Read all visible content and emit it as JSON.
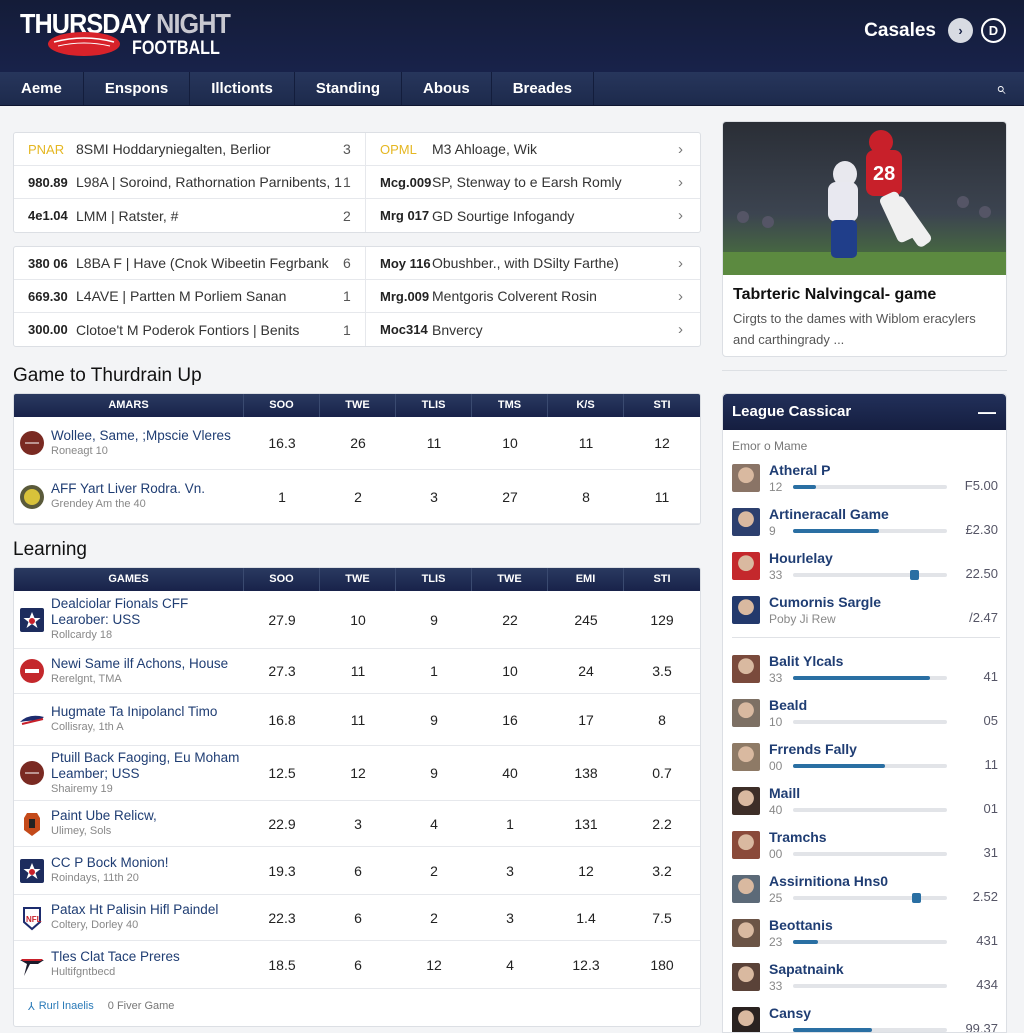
{
  "header": {
    "logo_text_1": "THURSDAY",
    "logo_text_2": "NIGHT",
    "logo_text_3": "FOOTBALL",
    "user_name": "Casales",
    "user_icon_1": "chevron-right-icon",
    "user_icon_2": "d-circle-icon"
  },
  "nav": {
    "items": [
      "Aeme",
      "Enspons",
      "Illctionts",
      "Standing",
      "Abous",
      "Breades"
    ],
    "search_icon": "search-icon"
  },
  "schedule_boxes": [
    [
      {
        "left": {
          "code": "PNAR",
          "text": "8SMI Hoddaryniegalten, Berlior",
          "num": "3"
        },
        "right": {
          "code": "OPML",
          "text": "M3 Ahloage, Wik"
        }
      },
      {
        "left": {
          "code": "980.89",
          "text": "L98A | Soroind, Rathornation Parnibents, 1",
          "num": "1"
        },
        "right": {
          "code": "Mcg.009",
          "text": "SP, Stenway to e Earsh Romly"
        }
      },
      {
        "left": {
          "code": "4e1.04",
          "text": "LMM | Ratster, #",
          "num": "2"
        },
        "right": {
          "code": "Mrg 017",
          "text": "GD Sourtige Infogandy"
        }
      }
    ],
    [
      {
        "left": {
          "code": "380 06",
          "text": "L8BA F | Have (Cnok Wibeetin Fegrbank",
          "num": "6"
        },
        "right": {
          "code": "Moy 116",
          "text": "Obushber., with DSilty Farthe)"
        }
      },
      {
        "left": {
          "code": "669.30",
          "text": "L4AVE | Partten M Porliem Sanan",
          "num": "1"
        },
        "right": {
          "code": "Mrg.009",
          "text": "Mentgoris Colverent Rosin"
        }
      },
      {
        "left": {
          "code": "300.00",
          "text": "Clotoe't M Poderok Fontiors | Benits",
          "num": "1"
        },
        "right": {
          "code": "Moc314",
          "text": "Bnvercy"
        }
      }
    ]
  ],
  "section1": {
    "title": "Game to Thurdrain Up",
    "columns": [
      "AMARS",
      "SOO",
      "TWE",
      "TLIS",
      "TMS",
      "K/S",
      "STI"
    ],
    "rows": [
      {
        "icon": "football-icon",
        "name": "Wollee, Same, ;Mpscie Vleres",
        "sub": "Roneagt 10",
        "values": [
          "16.3",
          "26",
          "11",
          "10",
          "11",
          "12"
        ]
      },
      {
        "icon": "team-badge-icon",
        "name": "AFF Yart Liver Rodra. Vn.",
        "sub": "Grendey Am the 40",
        "values": [
          "1",
          "2",
          "3",
          "27",
          "8",
          "11"
        ]
      }
    ]
  },
  "section2": {
    "title": "Learning",
    "columns": [
      "GAMES",
      "SOO",
      "TWE",
      "TLIS",
      "TWE",
      "EMI",
      "STI"
    ],
    "rows": [
      {
        "icon": "star-shield-icon",
        "name": "Dealciolar Fionals CFF",
        "name2": "Learober: USS",
        "sub": "Rollcardy 18",
        "values": [
          "27.9",
          "10",
          "9",
          "22",
          "245",
          "129"
        ]
      },
      {
        "icon": "helmet-icon",
        "name": "Newi Same ilf Achons, House",
        "sub": "Rerelgnt, TMA",
        "values": [
          "27.3",
          "11",
          "1",
          "10",
          "24",
          "3.5"
        ]
      },
      {
        "icon": "bison-icon",
        "name": "Hugmate Ta Inipolancl Timo",
        "sub": "Collisray, 1th A",
        "values": [
          "16.8",
          "11",
          "9",
          "16",
          "17",
          "8"
        ]
      },
      {
        "icon": "football-icon",
        "name": "Ptuill Back Faoging, Eu Moham",
        "name2": "Leamber; USS",
        "sub": "Shairemy 19",
        "values": [
          "12.5",
          "12",
          "9",
          "40",
          "138",
          "0.7"
        ]
      },
      {
        "icon": "shield-icon",
        "name": "Paint Ube Relicw,",
        "sub": "Ulimey, Sols",
        "values": [
          "22.9",
          "3",
          "4",
          "1",
          "131",
          "2.2"
        ]
      },
      {
        "icon": "star-shield-icon",
        "name": "CC P Bock Monion!",
        "sub": "Roindays, 11th 20",
        "values": [
          "19.3",
          "6",
          "2",
          "3",
          "12",
          "3.2"
        ]
      },
      {
        "icon": "nfl-shield-icon",
        "name": "Patax Ht Palisin Hifl Paindel",
        "sub": "Coltery, Dorley 40",
        "values": [
          "22.3",
          "6",
          "2",
          "3",
          "1.4",
          "7.5"
        ]
      },
      {
        "icon": "bird-logo-icon",
        "name": "Tles Clat Tace Preres",
        "sub": "Hultifgntbecd",
        "values": [
          "18.5",
          "6",
          "12",
          "4",
          "12.3",
          "180"
        ]
      }
    ],
    "footer_link": "Rurl Inaelis",
    "footer_text": "0 Fiver Game",
    "footer_icon": "filter-icon"
  },
  "feature": {
    "title": "Tabrteric Nalvingcal- game",
    "desc": "Cirgts to the dames with Wiblom eracylers and carthingrady ..."
  },
  "league": {
    "title": "League Cassicar",
    "collapse_icon": "minus-icon",
    "subtitle": "Emor o Mame",
    "group1": [
      {
        "name": "Atheral P",
        "sub": "12",
        "value": "F5.00",
        "progress": 0.15,
        "avatar": "#8a7466"
      },
      {
        "name": "Artineracall Game",
        "sub": "9",
        "value": "£2.30",
        "progress": 0.56,
        "avatar": "#2c3f6e"
      },
      {
        "name": "Hourlelay",
        "sub": "33",
        "value": "22.50",
        "knob": 0.76,
        "avatar": "#c4282c"
      },
      {
        "name": "Cumornis Sargle",
        "sub": "Poby Ji Rew",
        "value": "/2.47",
        "avatar": "#23396c"
      }
    ],
    "group2": [
      {
        "name": "Balit Ylcals",
        "sub": "33",
        "value": "41",
        "progress": 0.89,
        "avatar": "#7a4a3c"
      },
      {
        "name": "Beald",
        "sub": "10",
        "value": "05",
        "progress": 0,
        "avatar": "#7d7064"
      },
      {
        "name": "Frrends Fally",
        "sub": "00",
        "value": "11",
        "progress": 0.6,
        "avatar": "#8e7a66"
      },
      {
        "name": "Maill",
        "sub": "40",
        "value": "01",
        "progress": 0,
        "avatar": "#3d2e28"
      },
      {
        "name": "Tramchs",
        "sub": "00",
        "value": "31",
        "progress": 0,
        "avatar": "#8a4a3a"
      },
      {
        "name": "Assirnitiona Hns0",
        "sub": "25",
        "value": "2.52",
        "knob": 0.77,
        "avatar": "#5c6a78"
      },
      {
        "name": "Beottanis",
        "sub": "23",
        "value": "431",
        "progress": 0.16,
        "avatar": "#6b5446"
      },
      {
        "name": "Sapatnaink",
        "sub": "33",
        "value": "434",
        "progress": 0,
        "avatar": "#5a4238"
      },
      {
        "name": "Cansy",
        "sub": "",
        "value": "99.37",
        "progress": 0.51,
        "avatar": "#2a2220"
      }
    ]
  },
  "colors": {
    "navy": "#18224a",
    "accent_blue": "#2a6fa3",
    "yellow_code": "#e5b722",
    "link": "#1f3d73"
  }
}
